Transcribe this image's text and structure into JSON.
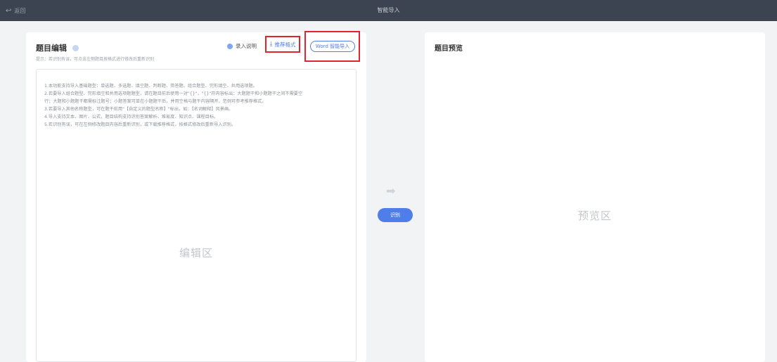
{
  "topbar": {
    "back_label": "返回",
    "back_icon": "undo-arrow",
    "title": "智能导入"
  },
  "editor_panel": {
    "title": "题目编辑",
    "tip": "提示：若识别有误，可点击左侧题目按格式进行修改后重新识别",
    "guide_label": "录入说明",
    "download_label": "推荐格式",
    "download_icon": "download",
    "word_button_label": "Word 智能导入",
    "help_lines": [
      "1.本功能支持导入基础题型：单选题、多选题、填空题、判断题、简答题、组合题型、完形填空、共用选项题。",
      "2.若要导入组合题型、完形填空和共用选项题题型，请在题目前后使用一对\"{}\"，\"{}\"符内容标出：大题题干和小题题干之间不需要空",
      "行；大题和小题题干都需标注题号；小题答案可单在小题题干后，并用空格与题干内容隔开。范例可参考推荐格式。",
      "3.若要导入其他名称题型，可在题干前用\"【自定义的题型名称】\"标出，如：【名词解释】风景画。",
      "4.导入支持文本、图片、公式，题目结构支持识别答案解析、难易度、知识点、课程目标。",
      "5.若识别有误，可在左侧修改题目内容后重新识别，或下载推荐格式，按格式修改后重新导入识别。"
    ],
    "placeholder": "编辑区"
  },
  "recognize": {
    "arrow_icon": "right-arrow",
    "button_label": "识别"
  },
  "preview_panel": {
    "title": "题目预览",
    "placeholder": "预览区"
  },
  "colors": {
    "topbar": "#3d4451",
    "accent": "#4f7de9",
    "highlight": "#e0262c"
  }
}
